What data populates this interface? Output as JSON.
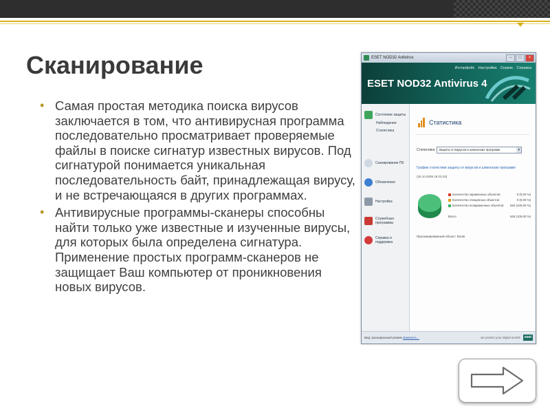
{
  "slide": {
    "title": "Сканирование",
    "bullets": [
      "Самая простая методика поиска вирусов заключается в том, что антивирусная программа последовательно просматривает проверяемые файлы в поиске сигнатур известных вирусов. Под сигнатурой понимается уникальная последовательность байт, принадлежащая вирусу, и не встречающаяся в других программах.",
      "Антивирусные программы-сканеры способны найти только уже известные и изученные вирусы, для которых была определена сигнатура. Применение простых программ-сканеров не защищает Ваш компьютер от проникновения новых вирусов."
    ],
    "bullet_glyph": "•",
    "colors": {
      "accent_gold": "#d8b21c",
      "title": "#3a3a3a",
      "text": "#3f3f3f"
    }
  },
  "app": {
    "window_title": "ESET NOD32 Antivirus",
    "brand": "ESET NOD32 Antivirus 4",
    "menu": [
      "Интерфейс",
      "Настройка",
      "Сервис",
      "Справка"
    ],
    "sidebar": [
      {
        "label": "Состояние защиты",
        "icon": "shield-check-icon",
        "sub": [
          "Наблюдение",
          "Статистика"
        ]
      },
      {
        "label": "Сканирование ПК",
        "icon": "magnifier-icon"
      },
      {
        "label": "Обновление",
        "icon": "globe-update-icon"
      },
      {
        "label": "Настройка",
        "icon": "gear-icon"
      },
      {
        "label": "Служебные программы",
        "icon": "toolbox-icon"
      },
      {
        "label": "Справка и поддержка",
        "icon": "help-icon"
      }
    ],
    "main": {
      "heading": "Статистика",
      "filter_label": "Статистика",
      "filter_value": "Защита от вирусов и шпионских программ",
      "chart_title": "График статистики защиты от вирусов и шпионских программ",
      "chart_date": "(26.10.2009 18:23:43)",
      "legend": [
        {
          "label": "Количество зараженных объектов",
          "value": "0 (0,00 %)",
          "color": "#d63a2f"
        },
        {
          "label": "Количество очищенных объектов",
          "value": "0 (0,00 %)",
          "color": "#e49a1e"
        },
        {
          "label": "Количество незараженных объектов",
          "value": "626 (100,00 %)",
          "color": "#34b06a"
        }
      ],
      "total_label": "Всего",
      "total_value": "626 (100,00 %)",
      "scanned_object": "Просканированный объект: Boots"
    },
    "status": {
      "mode_text": "Вид: расширенный режим",
      "mode_link": "Изменить...",
      "tagline": "we protect your digital worlds",
      "logo_text": "eset"
    }
  },
  "nav": {
    "next_icon": "arrow-right-icon"
  }
}
